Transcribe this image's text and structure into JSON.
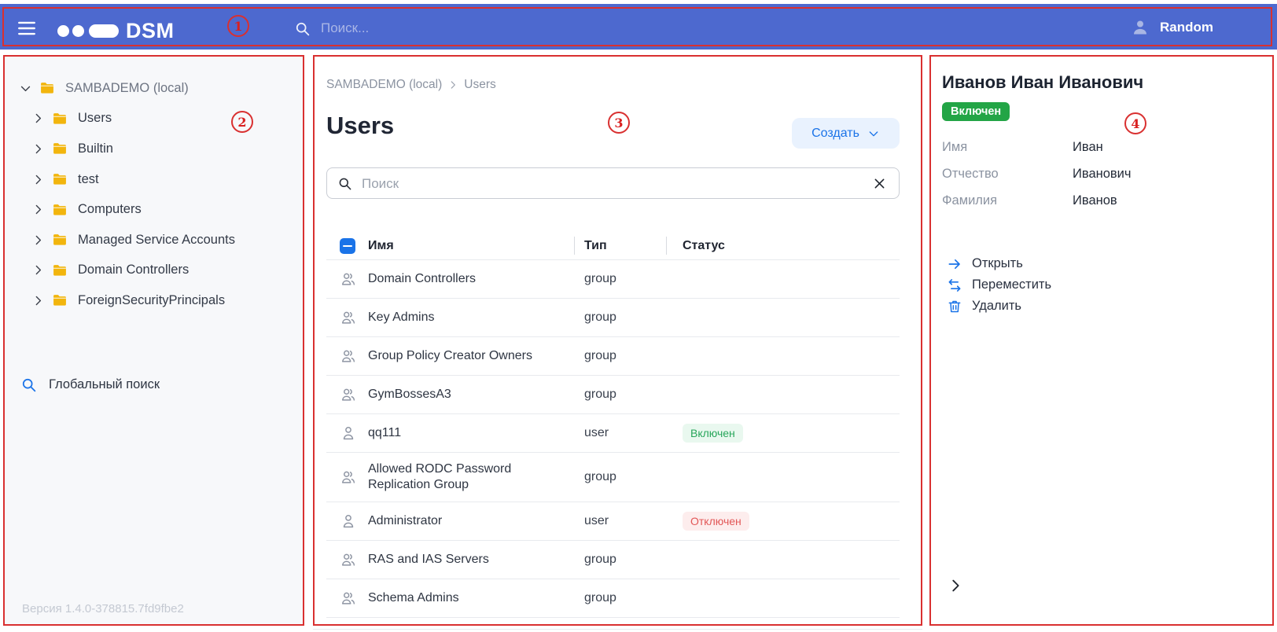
{
  "annotations": {
    "items": [
      "1",
      "2",
      "3",
      "4"
    ]
  },
  "header": {
    "logo_text": "DSM",
    "search_placeholder": "Поиск...",
    "user_name": "Random"
  },
  "sidebar": {
    "tree": [
      {
        "label": "SAMBADEMO (local)"
      },
      {
        "label": "Users"
      },
      {
        "label": "Builtin"
      },
      {
        "label": "test"
      },
      {
        "label": "Computers"
      },
      {
        "label": "Managed Service Accounts"
      },
      {
        "label": "Domain Controllers"
      },
      {
        "label": "ForeignSecurityPrincipals"
      }
    ],
    "global_search_label": "Глобальный поиск",
    "version": "Версия 1.4.0-378815.7fd9fbe2"
  },
  "main": {
    "breadcrumb": [
      "SAMBADEMO (local)",
      "Users"
    ],
    "title": "Users",
    "create_button_label": "Создать",
    "search_placeholder": "Поиск",
    "table": {
      "columns": [
        "Имя",
        "Тип",
        "Статус"
      ],
      "rows": [
        {
          "name": "Domain Controllers",
          "type": "group",
          "status": ""
        },
        {
          "name": "Key Admins",
          "type": "group",
          "status": ""
        },
        {
          "name": "Group Policy Creator Owners",
          "type": "group",
          "status": ""
        },
        {
          "name": "GymBossesA3",
          "type": "group",
          "status": ""
        },
        {
          "name": "qq111",
          "type": "user",
          "status": "Включен"
        },
        {
          "name": "Allowed RODC Password Replication Group",
          "type": "group",
          "status": ""
        },
        {
          "name": "Administrator",
          "type": "user",
          "status": "Отключен"
        },
        {
          "name": "RAS and IAS Servers",
          "type": "group",
          "status": ""
        },
        {
          "name": "Schema Admins",
          "type": "group",
          "status": ""
        }
      ]
    }
  },
  "details": {
    "title": "Иванов Иван Иванович",
    "status_badge": "Включен",
    "fields": [
      {
        "label": "Имя",
        "value": "Иван"
      },
      {
        "label": "Отчество",
        "value": "Иванович"
      },
      {
        "label": "Фамилия",
        "value": "Иванов"
      }
    ],
    "actions": [
      {
        "label": "Открыть"
      },
      {
        "label": "Переместить"
      },
      {
        "label": "Удалить"
      }
    ]
  },
  "colors": {
    "header_bg": "#4d69cf",
    "accent_blue": "#1a73e8",
    "annotation_red": "#d93030",
    "folder_yellow": "#f2b50d",
    "status_enabled_bg": "#e9f8ef",
    "status_enabled_text": "#27a65a",
    "status_disabled_bg": "#fdeded",
    "status_disabled_text": "#e25757",
    "badge_enabled_solid": "#23a546",
    "sidebar_bg": "#f7f8fa"
  }
}
